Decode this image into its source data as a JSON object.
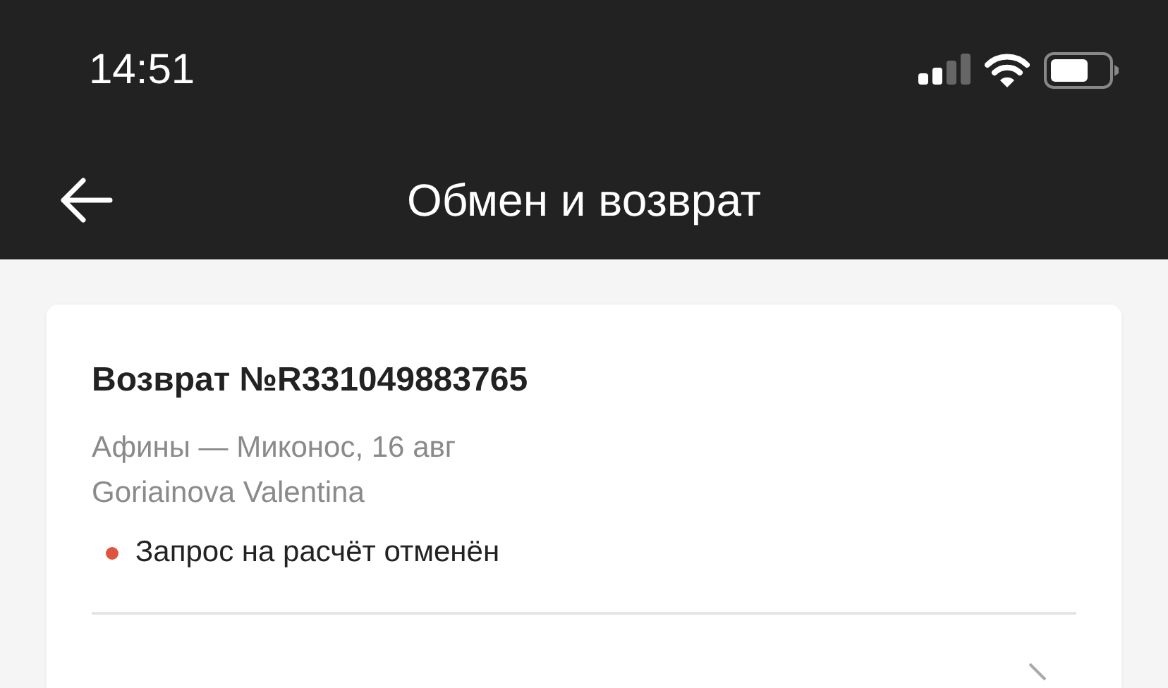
{
  "status_bar": {
    "time": "14:51"
  },
  "header": {
    "title": "Обмен и возврат"
  },
  "card": {
    "title": "Возврат №R331049883765",
    "route": "Афины — Миконос, 16 авг",
    "passenger": "Goriainova Valentina",
    "status": {
      "text": "Запрос на расчёт отменён",
      "color": "#e0533f"
    }
  }
}
